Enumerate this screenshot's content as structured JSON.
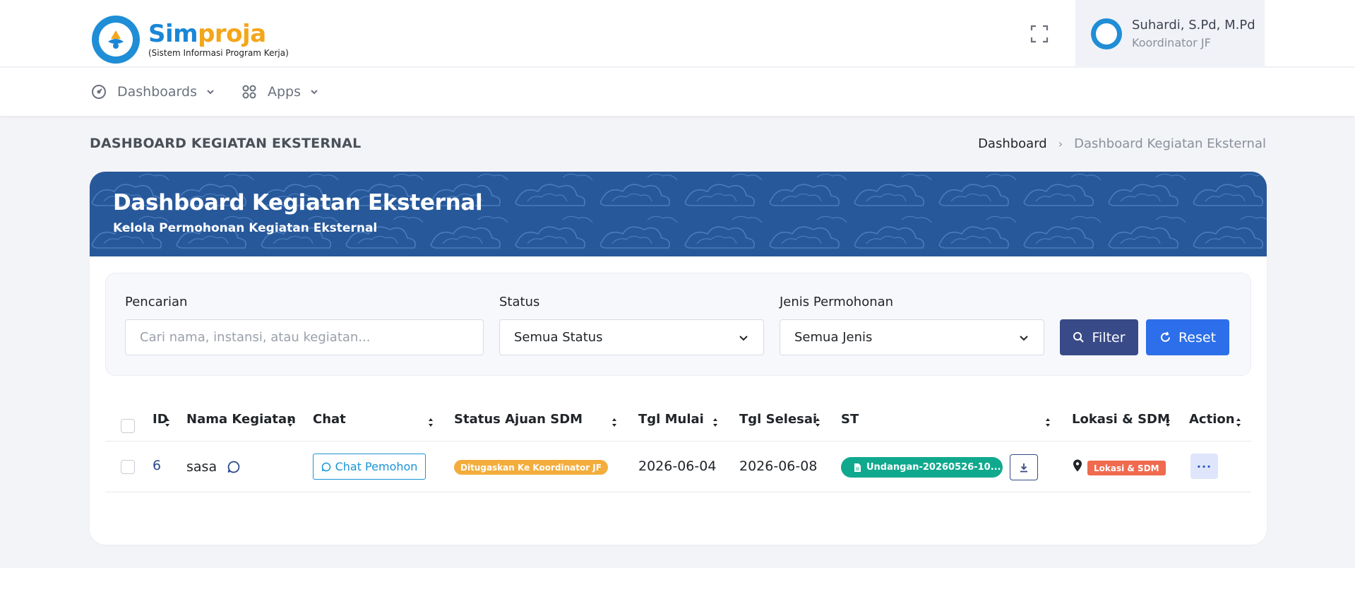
{
  "brand": {
    "name_part1": "Sim",
    "name_part2": "proja",
    "subtitle": "(Sistem Informasi Program Kerja)"
  },
  "user": {
    "name": "Suhardi, S.Pd, M.Pd",
    "role": "Koordinator JF"
  },
  "nav": {
    "items": [
      {
        "label": "Dashboards",
        "icon": "speedometer-icon"
      },
      {
        "label": "Apps",
        "icon": "grid-icon"
      }
    ]
  },
  "page": {
    "title": "DASHBOARD KEGIATAN EKSTERNAL",
    "breadcrumb": [
      "Dashboard",
      "Dashboard Kegiatan Eksternal"
    ]
  },
  "banner": {
    "title": "Dashboard Kegiatan Eksternal",
    "subtitle": "Kelola Permohonan Kegiatan Eksternal"
  },
  "filters": {
    "search_label": "Pencarian",
    "search_placeholder": "Cari nama, instansi, atau kegiatan...",
    "status_label": "Status",
    "status_value": "Semua Status",
    "jenis_label": "Jenis Permohonan",
    "jenis_value": "Semua Jenis",
    "filter_button": "Filter",
    "reset_button": "Reset"
  },
  "table": {
    "columns": [
      "ID",
      "Nama Kegiatan",
      "Chat",
      "Status Ajuan SDM",
      "Tgl Mulai",
      "Tgl Selesai",
      "ST",
      "Lokasi & SDM",
      "Action"
    ],
    "rows": [
      {
        "id": "6",
        "nama": "sasa",
        "chat_button": "Chat Pemohon",
        "status": "Ditugaskan Ke Koordinator JF",
        "tgl_mulai": "2026-06-04",
        "tgl_selesai": "2026-06-08",
        "st_file": "Undangan-20260526-10...",
        "lokasi_badge": "Lokasi & SDM",
        "action": "···"
      }
    ]
  },
  "colors": {
    "brand_blue": "#1a86d6",
    "brand_orange": "#f4a61a",
    "banner": "#27589a",
    "filter_btn": "#384a87",
    "reset_btn": "#2d6fea",
    "status_badge": "#f3ad3c",
    "st_badge": "#10a98e",
    "lokasi_badge": "#ef6a4f"
  }
}
